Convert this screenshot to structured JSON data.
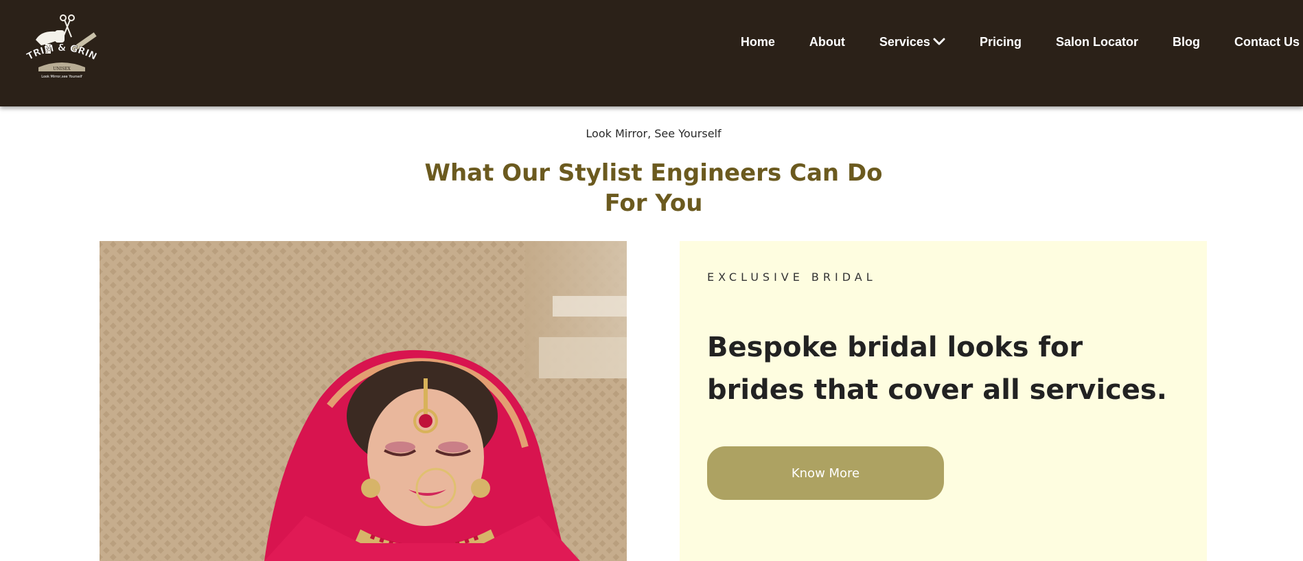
{
  "brand": {
    "logo_text": "TRIM & GRIN",
    "logo_sub": "UNISEX",
    "logo_tagline": "Look Mirror,see Yourself"
  },
  "nav": {
    "home": "Home",
    "about": "About",
    "services": "Services",
    "pricing": "Pricing",
    "salon_locator": "Salon Locator",
    "blog": "Blog",
    "contact": "Contact Us"
  },
  "intro": {
    "tagline": "Look Mirror, See Yourself",
    "title_line1": "What Our Stylist Engineers Can Do",
    "title_line2": "For You"
  },
  "feature": {
    "eyebrow": "EXCLUSIVE BRIDAL",
    "heading_bold": "Bespoke bridal looks",
    "heading_rest": " for brides that cover all services.",
    "button_label": "Know More"
  },
  "colors": {
    "header_bg": "#2b2118",
    "title": "#6b5a1f",
    "card_bg": "#fefde0",
    "button_bg": "#ada262"
  },
  "icons": {
    "logo": "salon-tools-logo-icon",
    "services_dropdown": "chevron-down-icon"
  }
}
